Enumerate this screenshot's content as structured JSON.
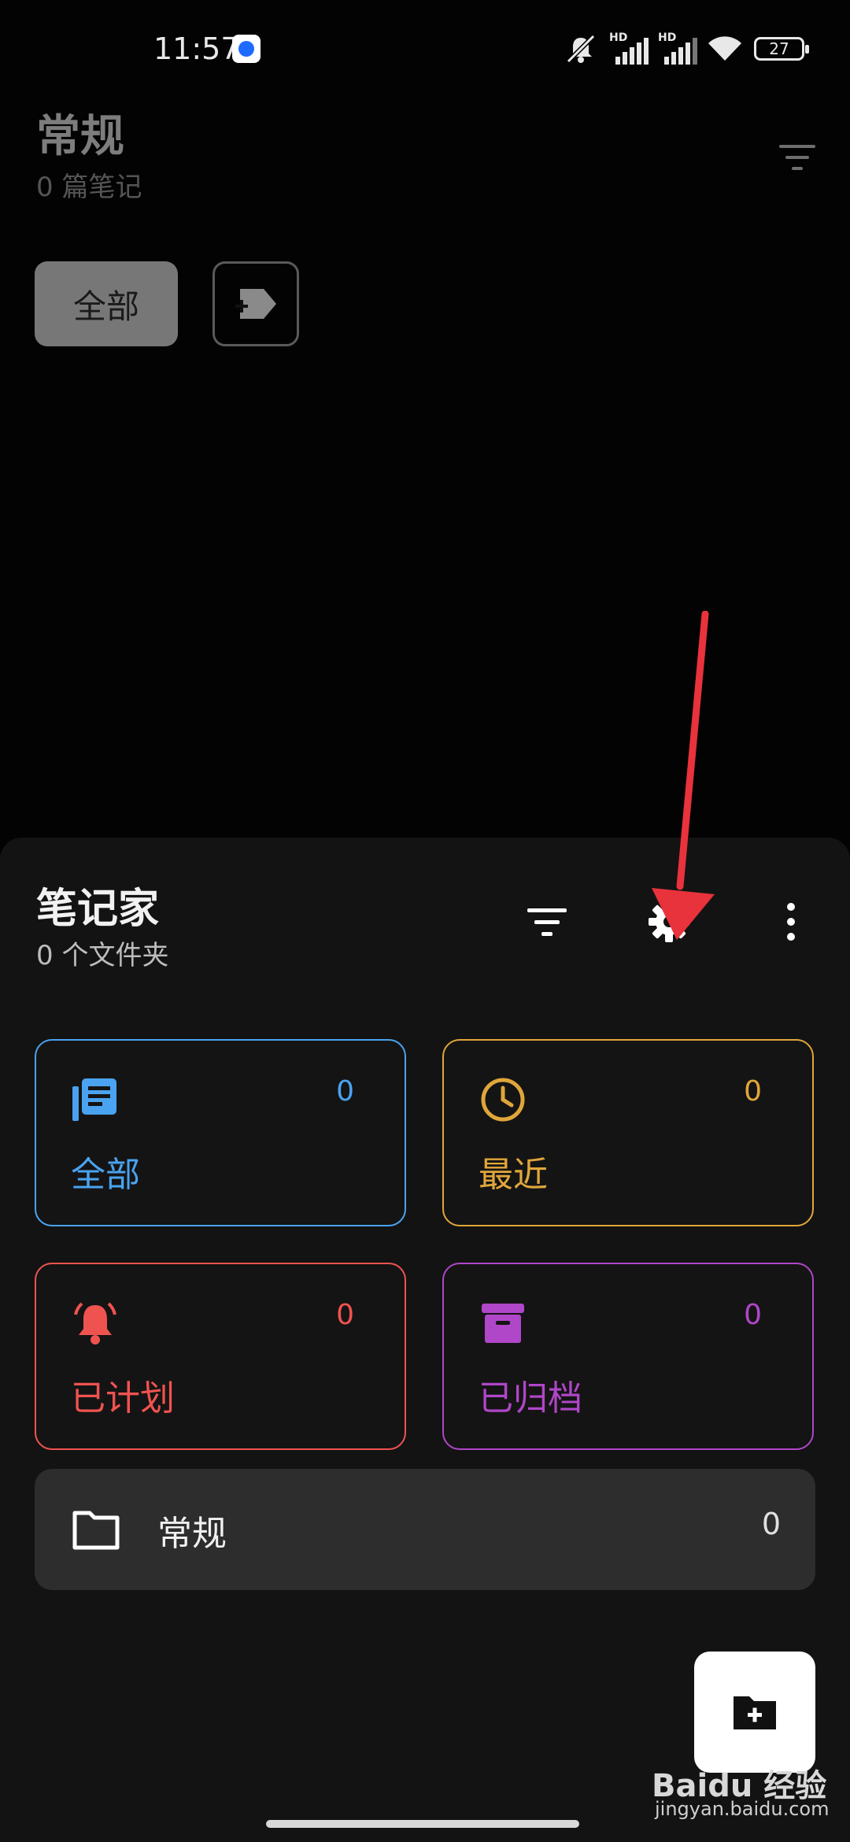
{
  "status_bar": {
    "time": "11:57",
    "battery": "27",
    "icons": [
      "mute-icon",
      "signal-hd-icon",
      "signal-hd-icon",
      "wifi-icon",
      "battery-icon"
    ]
  },
  "background_page": {
    "title": "常规",
    "subtitle": "0 篇笔记",
    "chip_all": "全部"
  },
  "sheet": {
    "title": "笔记家",
    "subtitle": "0 个文件夹",
    "cards": [
      {
        "label": "全部",
        "count": "0",
        "icon": "notes-stack-icon",
        "color": "#4aa3f0"
      },
      {
        "label": "最近",
        "count": "0",
        "icon": "clock-icon",
        "color": "#e0a63a"
      },
      {
        "label": "已计划",
        "count": "0",
        "icon": "bell-icon",
        "color": "#ef5350"
      },
      {
        "label": "已归档",
        "count": "0",
        "icon": "archive-icon",
        "color": "#b046c8"
      }
    ],
    "folder": {
      "label": "常规",
      "count": "0"
    }
  },
  "watermark": {
    "brand": "Baidu 经验",
    "url": "jingyan.baidu.com"
  }
}
